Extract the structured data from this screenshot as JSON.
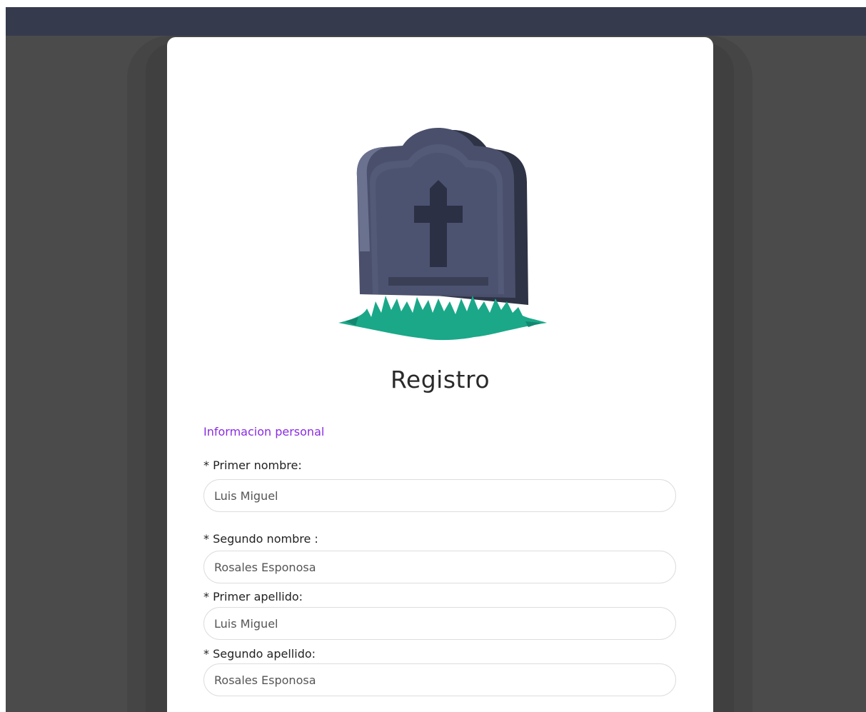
{
  "app": {
    "colors": {
      "topbar": "#353a4d",
      "backdrop": "#4b4b4b",
      "card": "#ffffff",
      "section_accent": "#8a2be2",
      "tombstone": "#4a506b",
      "grass": "#1aa889"
    }
  },
  "page": {
    "illustration": "tombstone-illustration",
    "title": "Registro",
    "section_label": "Informacion personal"
  },
  "form": {
    "fields": [
      {
        "label": "* Primer nombre:",
        "value": "Luis Miguel"
      },
      {
        "label": "* Segundo nombre :",
        "value": "Rosales Esponosa"
      },
      {
        "label": "* Primer apellido:",
        "value": "Luis Miguel"
      },
      {
        "label": "* Segundo apellido:",
        "value": "Rosales Esponosa"
      }
    ]
  }
}
